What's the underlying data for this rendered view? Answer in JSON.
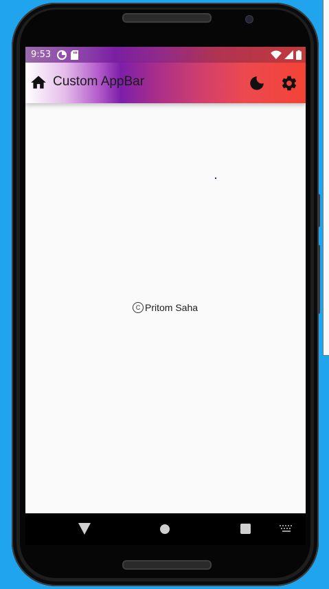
{
  "status_bar": {
    "time": "9:53",
    "left_icons": [
      "data-saver-icon",
      "sd-card-icon"
    ],
    "right_icons": [
      "wifi-icon",
      "signal-icon",
      "battery-icon"
    ]
  },
  "app_bar": {
    "title": "Custom AppBar",
    "leading_icon": "home-icon",
    "actions": [
      "moon-icon",
      "gear-icon"
    ],
    "gradient_colors": [
      "#ffffff",
      "#7d1faa",
      "#f44336"
    ]
  },
  "body": {
    "footer_symbol": "C",
    "footer_text": "Pritom Saha"
  },
  "nav_bar": {
    "buttons": [
      "back-icon",
      "home-circle-icon",
      "recents-icon",
      "keyboard-icon"
    ]
  },
  "colors": {
    "accent_purple": "#7d1faa",
    "accent_red": "#f44336",
    "background": "#fafafa",
    "desktop": "#20a4ee"
  }
}
